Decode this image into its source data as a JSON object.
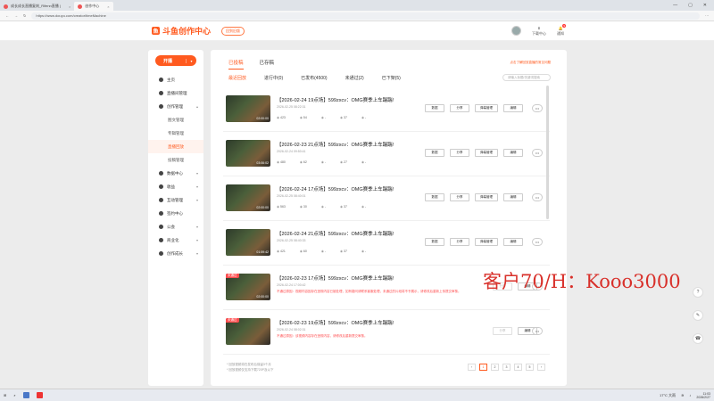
{
  "browser": {
    "tabs": [
      {
        "label": "成长成长直播复刻_Rifenn直播 |",
        "active": false
      },
      {
        "label": "创作中心",
        "active": true
      }
    ],
    "url": "https://www.douyu.com/creator/timeMachine"
  },
  "header": {
    "logo_text": "斗鱼创作中心",
    "badge": "回到旧版",
    "icons": [
      {
        "name": "下载中心",
        "badge": ""
      },
      {
        "name": "通知",
        "badge": "9"
      }
    ]
  },
  "sidebar": {
    "start_label": "开播",
    "items": [
      {
        "label": "主页",
        "type": "item"
      },
      {
        "label": "直播间管理",
        "type": "item"
      },
      {
        "label": "创作管理",
        "type": "item",
        "expanded": true
      },
      {
        "label": "图文管理",
        "type": "sub"
      },
      {
        "label": "专辑管理",
        "type": "sub"
      },
      {
        "label": "直播回放",
        "type": "sub",
        "active": true
      },
      {
        "label": "投稿管理",
        "type": "sub"
      },
      {
        "label": "数据中心",
        "type": "item",
        "arrow": true
      },
      {
        "label": "收益",
        "type": "item",
        "arrow": true
      },
      {
        "label": "互动管理",
        "type": "item",
        "arrow": true
      },
      {
        "label": "签约中心",
        "type": "item"
      },
      {
        "label": "公会",
        "type": "item",
        "arrow": true
      },
      {
        "label": "商业化",
        "type": "item",
        "arrow": true
      },
      {
        "label": "创作成长",
        "type": "item",
        "arrow": true
      }
    ]
  },
  "main": {
    "top_note": "点击了解回放直播的常见问题",
    "tabs": [
      "已投稿",
      "已存稿"
    ],
    "filters": [
      "最近回放",
      "进行中(0)",
      "已发布(4500)",
      "未通过(2)",
      "已下架(5)"
    ],
    "search_placeholder": "请输入标题/关键词搜索",
    "rows": [
      {
        "title": "【2026-02-24 19点场】599zxcv：OMG赛季上车踹踹!",
        "date": "2026-02-25 08:22:31",
        "duration": "02:00:00",
        "status": "",
        "notice": "",
        "stats": [
          "423",
          "54",
          "-",
          "37",
          "-"
        ],
        "actions": [
          "数据",
          "分享",
          "弹幕管理",
          "编辑"
        ],
        "disabled": []
      },
      {
        "title": "【2026-02-23 21点场】599zxcv：OMG赛季上车踹踹!",
        "date": "2026-02-24 09:50:41",
        "duration": "03:06:02",
        "status": "",
        "notice": "",
        "stats": [
          "480",
          "62",
          "-",
          "27",
          "-"
        ],
        "actions": [
          "数据",
          "分享",
          "弹幕管理",
          "编辑"
        ],
        "disabled": []
      },
      {
        "title": "【2026-02-24 17点场】599zxcv：OMG赛季上车踹踹!",
        "date": "2026-02-25 08:40:01",
        "duration": "02:00:00",
        "status": "",
        "notice": "",
        "stats": [
          "563",
          "30",
          "-",
          "37",
          "-"
        ],
        "actions": [
          "数据",
          "分享",
          "弹幕管理",
          "编辑"
        ],
        "disabled": []
      },
      {
        "title": "【2026-02-24 21点场】599zxcv：OMG赛季上车踹踹!",
        "date": "2026-02-25 08:40:33",
        "duration": "01:59:42",
        "status": "",
        "notice": "",
        "stats": [
          "421",
          "60",
          "-",
          "37",
          "-"
        ],
        "actions": [
          "数据",
          "分享",
          "弹幕管理",
          "编辑"
        ],
        "disabled": []
      },
      {
        "title": "【2026-02-23 17点场】599zxcv：OMG赛季上车踹踹!",
        "date": "2026-02-24 17:00:42",
        "duration": "02:00:00",
        "status": "未通过",
        "notice": "不通过原因：视频内容因存在违规内容已被处理，如有疑问请联系客服处理，未通过的片段将不予展示，请修改后重新上传提交审核。",
        "stats": [],
        "actions": [
          "分享",
          "编辑"
        ],
        "disabled": [
          "分享"
        ]
      },
      {
        "title": "【2026-02-23 19点场】599zxcv：OMG赛季上车踹踹!",
        "date": "2026-02-24 08:02:31",
        "duration": "",
        "status": "未通过",
        "notice": "不通过原因：该视频内容存在违规内容，请修改后重新提交审核。",
        "stats": [],
        "actions": [
          "分享",
          "编辑"
        ],
        "disabled": [
          "分享"
        ]
      }
    ],
    "footnotes": [
      "* 回放视频将在发布后保留3个月",
      "* 回放视频仅支持下载720P及以下"
    ],
    "pager": [
      "‹",
      "1",
      "2",
      "3",
      "4",
      "5",
      "›"
    ]
  },
  "watermark": "客户70/H：Kooo3000",
  "taskbar": {
    "weather": "17°C 大雨",
    "time": "11:03",
    "date": "2026/2/27"
  }
}
